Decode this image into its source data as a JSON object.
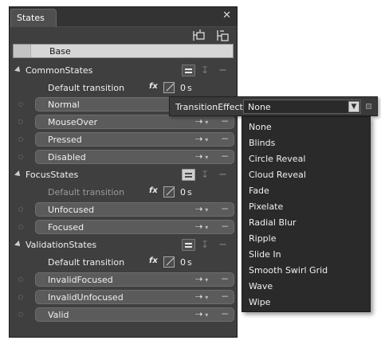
{
  "panel": {
    "tab_label": "States",
    "close_glyph": "✕",
    "base_label": "Base"
  },
  "groups": [
    {
      "name": "CommonStates",
      "transition_label": "Default transition",
      "duration": "0",
      "duration_unit": "s",
      "states": [
        "Normal",
        "MouseOver",
        "Pressed",
        "Disabled"
      ]
    },
    {
      "name": "FocusStates",
      "transition_label": "Default transition",
      "duration": "0",
      "duration_unit": "s",
      "states": [
        "Unfocused",
        "Focused"
      ]
    },
    {
      "name": "ValidationStates",
      "transition_label": "Default transition",
      "duration": "0",
      "duration_unit": "s",
      "states": [
        "InvalidFocused",
        "InvalidUnfocused",
        "Valid"
      ]
    }
  ],
  "transition_effect": {
    "label": "TransitionEffect",
    "selected": "None",
    "options": [
      "None",
      "Blinds",
      "Circle Reveal",
      "Cloud Reveal",
      "Fade",
      "Pixelate",
      "Radial Blur",
      "Ripple",
      "Slide In",
      "Smooth Swirl Grid",
      "Wave",
      "Wipe"
    ]
  },
  "icons": {
    "add_state_group": "add-state-group-icon",
    "add_state": "add-state-icon",
    "easing": "easing-toggle-icon",
    "add_transition": "add-transition-icon",
    "remove": "minus-icon",
    "transition_effect": "fx-icon",
    "easing_function": "easing-function-icon",
    "dropdown_arrow": "chevron-down-icon"
  }
}
